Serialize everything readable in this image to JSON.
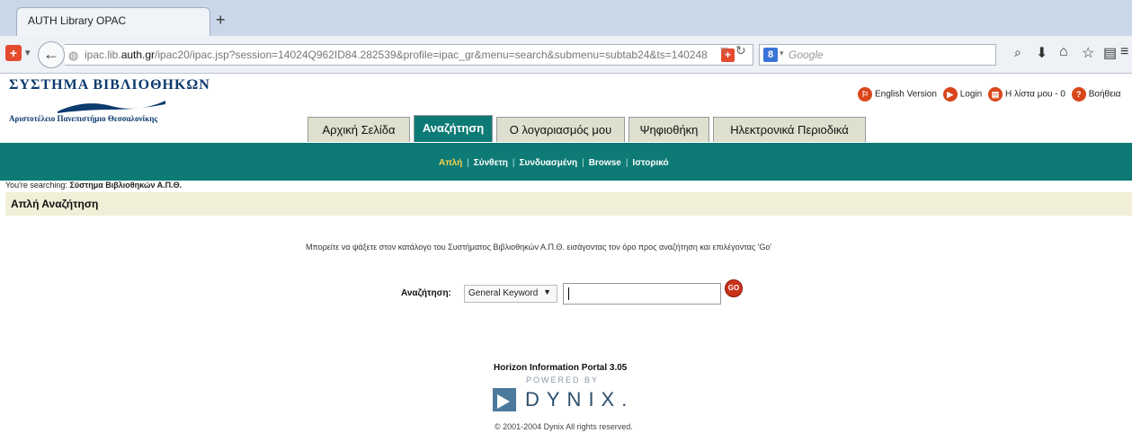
{
  "browser": {
    "tab_title": "AUTH Library OPAC",
    "new_tab": "+",
    "url_domain_pre": "ipac.lib.",
    "url_domain_bold": "auth.gr",
    "url_rest": "/ipac20/ipac.jsp?session=14024Q962ID84.282539&profile=ipac_gr&menu=search&submenu=subtab24&ts=140248",
    "search_placeholder": "Google"
  },
  "site": {
    "logo_title": "ΣΥΣΤΗΜΑ ΒΙΒΛΙΟΘΗΚΩΝ",
    "logo_subtitle": "Αριστοτέλειο Πανεπιστήμιο Θεσσαλονίκης",
    "toplinks": {
      "english": "English Version",
      "login": "Login",
      "mylist": "Η λίστα μου - 0",
      "help": "Βοήθεια"
    },
    "tabs": [
      "Αρχική Σελίδα",
      "Αναζήτηση",
      "Ο λογαριασμός μου",
      "Ψηφιοθήκη",
      "Ηλεκτρονικά Περιοδικά"
    ],
    "active_tab": "Αναζήτηση",
    "subnav": [
      "Απλή",
      "Σύνθετη",
      "Συνδυασμένη",
      "Browse",
      "Ιστορικό"
    ],
    "searching_prefix": "You're searching:",
    "searching_value": "Σύστημα Βιβλιοθηκών Α.Π.Θ.",
    "page_title": "Απλή Αναζήτηση",
    "intro": "Μπορείτε να ψάξετε στον κατάλογο του Συστήματος Βιβλιοθηκών Α.Π.Θ. εισάγοντας τον όρο προς αναζήτηση και επιλέγοντας 'Go'",
    "search_label": "Αναζήτηση:",
    "search_select": "General Keyword",
    "search_value": "",
    "go_label": "GO"
  },
  "footer": {
    "product": "Horizon Information Portal 3.05",
    "powered": "POWERED BY",
    "vendor": "DYNIX.",
    "copyright": "© 2001-2004 Dynix All rights reserved."
  }
}
